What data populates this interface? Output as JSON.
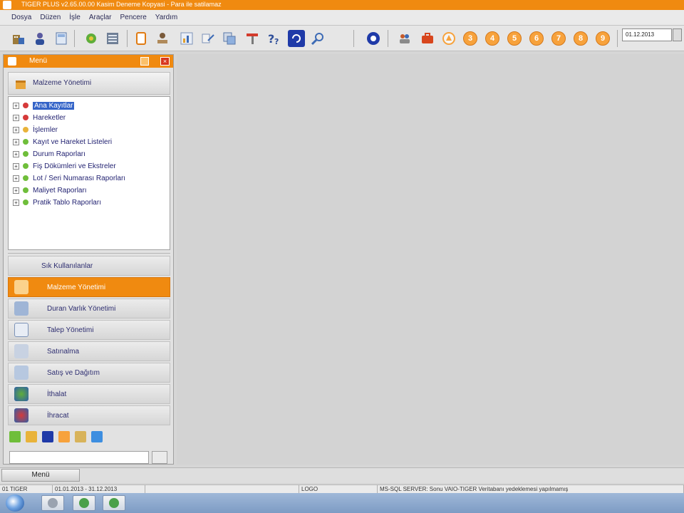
{
  "window": {
    "title": "TIGER PLUS v2.65.00.00 Kasim Deneme Kopyasi - Para ile satilamaz"
  },
  "menubar": {
    "items": [
      {
        "label": "Dosya"
      },
      {
        "label": "Düzen"
      },
      {
        "label": "İşle"
      },
      {
        "label": "Araçlar"
      },
      {
        "label": "Pencere"
      },
      {
        "label": "Yardım"
      }
    ]
  },
  "toolbar": {
    "icons": [
      "company-icon",
      "user-icon",
      "calculator-icon",
      "puzzle-icon",
      "grid-icon",
      "document-icon",
      "stamp-icon",
      "chart-icon",
      "transfer-icon",
      "copy-icon",
      "tools-icon",
      "help-icon",
      "tutorial-icon",
      "search-icon"
    ],
    "quick_numbers": [
      "3",
      "4",
      "5",
      "6",
      "7",
      "8",
      "9"
    ],
    "date": "01.12.2013"
  },
  "menu_panel": {
    "header_title": "Menü",
    "section_title": "Malzeme Yönetimi",
    "tree": [
      {
        "label": "Ana Kayıtlar",
        "selected": true,
        "color": "#d63a3a"
      },
      {
        "label": "Hareketler",
        "selected": false,
        "color": "#d63a3a"
      },
      {
        "label": "İşlemler",
        "selected": false,
        "color": "#e9b33a"
      },
      {
        "label": "Kayıt ve Hareket Listeleri",
        "selected": false,
        "color": "#6fbe3a"
      },
      {
        "label": "Durum Raporları",
        "selected": false,
        "color": "#6fbe3a"
      },
      {
        "label": "Fiş Dökümleri ve Ekstreler",
        "selected": false,
        "color": "#6fbe3a"
      },
      {
        "label": "Lot / Seri Numarası Raporları",
        "selected": false,
        "color": "#6fbe3a"
      },
      {
        "label": "Maliyet Raporları",
        "selected": false,
        "color": "#6fbe3a"
      },
      {
        "label": "Pratik Tablo Raporları",
        "selected": false,
        "color": "#6fbe3a"
      }
    ],
    "nav_buttons": [
      {
        "label": "Sık Kullanılanlar",
        "active": false
      },
      {
        "label": "Malzeme Yönetimi",
        "active": true
      },
      {
        "label": "Duran Varlık Yönetimi",
        "active": false
      },
      {
        "label": "Talep Yönetimi",
        "active": false
      },
      {
        "label": "Satınalma",
        "active": false
      },
      {
        "label": "Satış ve Dağıtım",
        "active": false
      },
      {
        "label": "İthalat",
        "active": false
      },
      {
        "label": "İhracat",
        "active": false
      }
    ]
  },
  "bottom": {
    "menu_tab_label": "Menü"
  },
  "statusbar": {
    "company": "01 TIGER",
    "period": "01.01.2013 - 31.12.2013",
    "logo": "LOGO",
    "message": "MS-SQL SERVER: Sonu VAIO-TIGER Veritabanı yedeklemesi yapılmamış"
  }
}
